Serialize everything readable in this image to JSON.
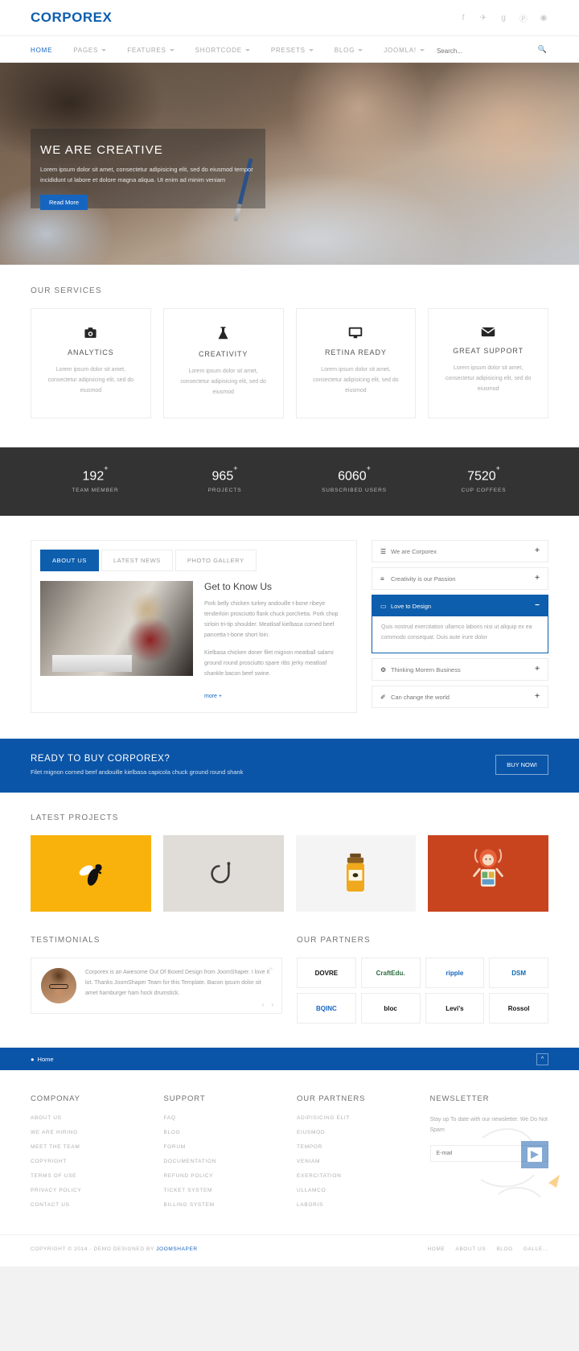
{
  "brand": {
    "logo": "CORPOREX",
    "accent": "#0d5ead",
    "dark": "#333333"
  },
  "topbar": {
    "social": [
      {
        "name": "facebook-icon",
        "glyph": "f"
      },
      {
        "name": "twitter-icon",
        "glyph": "✈"
      },
      {
        "name": "google-plus-icon",
        "glyph": "g"
      },
      {
        "name": "pinterest-icon",
        "glyph": "Ⓟ"
      },
      {
        "name": "dribbble-icon",
        "glyph": "◉"
      }
    ]
  },
  "nav": {
    "items": [
      {
        "label": "HOME",
        "caret": false,
        "active": true
      },
      {
        "label": "PAGES",
        "caret": true,
        "active": false
      },
      {
        "label": "FEATURES",
        "caret": true,
        "active": false
      },
      {
        "label": "SHORTCODE",
        "caret": true,
        "active": false
      },
      {
        "label": "PRESETS",
        "caret": true,
        "active": false
      },
      {
        "label": "BLOG",
        "caret": true,
        "active": false
      },
      {
        "label": "JOOMLA!",
        "caret": true,
        "active": false
      }
    ],
    "search": {
      "placeholder": "Search...",
      "value": ""
    }
  },
  "hero": {
    "title": "WE ARE CREATIVE",
    "subtitle": "Lorem ipsum dolor sit amet, consectetur adipisicing elit, sed do eiusmod tempor incididunt ut labore et dolore magna aliqua. Ut enim ad minim veniam",
    "button": "Read More"
  },
  "services": {
    "title": "OUR SERVICES",
    "items": [
      {
        "icon": "camera-icon",
        "name": "ANALYTICS",
        "desc": "Lorem ipsum dolor sit amet, consectetur adipisicing elit, sed do eiusmod"
      },
      {
        "icon": "flask-icon",
        "name": "CREATIVITY",
        "desc": "Lorem ipsum dolor sit amet, consectetur adipisicing elit, sed do eiusmod"
      },
      {
        "icon": "monitor-icon",
        "name": "RETINA READY",
        "desc": "Lorem ipsum dolor sit amet, consectetur adipisicing elit, sed do eiusmod"
      },
      {
        "icon": "envelope-icon",
        "name": "GREAT SUPPORT",
        "desc": "Lorem ipsum dolor sit amet, consectetur adipisicing elit, sed do eiusmod"
      }
    ]
  },
  "counters": [
    {
      "value": "192",
      "suffix": "+",
      "label": "TEAM MEMBER"
    },
    {
      "value": "965",
      "suffix": "+",
      "label": "PROJECTS"
    },
    {
      "value": "6060",
      "suffix": "+",
      "label": "SUBSCRIBED USERS"
    },
    {
      "value": "7520",
      "suffix": "+",
      "label": "CUP COFFEES"
    }
  ],
  "about": {
    "tabs": [
      {
        "label": "ABOUT US",
        "active": true
      },
      {
        "label": "LATEST NEWS",
        "active": false
      },
      {
        "label": "PHOTO GALLERY",
        "active": false
      }
    ],
    "heading": "Get to Know Us",
    "p1": "Pork belly chicken turkey andouille t-bone ribeye tenderloin prosciutto flank chuck porchetta. Pork chop sirloin tri-tip shoulder. Meatloaf kielbasa corned beef pancetta t-bone short loin.",
    "p2": "Kielbasa chicken doner filet mignon meatball salami ground round prosciutto spare ribs jerky meatloaf shankle bacon beef swine.",
    "more": "more +"
  },
  "accordion": [
    {
      "icon": "file-icon",
      "glyph": "☰",
      "title": "We are Corporex",
      "sign": "+",
      "open": false,
      "body": ""
    },
    {
      "icon": "layers-icon",
      "glyph": "≡",
      "title": "Creativity is our Passion",
      "sign": "+",
      "open": false,
      "body": ""
    },
    {
      "icon": "laptop-icon",
      "glyph": "▭",
      "title": "Love to Design",
      "sign": "−",
      "open": true,
      "body": "Quis nostrud exercitation ullamco laboris nisi ut aliquip ex ea commodo consequat. Duis aute irure dolor"
    },
    {
      "icon": "gear-icon",
      "glyph": "⚙",
      "title": "Thinking Morern Business",
      "sign": "+",
      "open": false,
      "body": ""
    },
    {
      "icon": "wrench-icon",
      "glyph": "✐",
      "title": "Can change the world",
      "sign": "+",
      "open": false,
      "body": ""
    }
  ],
  "cta": {
    "heading": "READY TO BUY CORPOREX?",
    "sub": "Filet mignon corned beef andouille kielbasa capicola chuck ground round shank",
    "button": "BUY NOW!"
  },
  "projects": {
    "title": "LATEST PROJECTS",
    "items": [
      {
        "name": "bee-logo-project",
        "bg": "#f9b20b"
      },
      {
        "name": "hook-logo-project",
        "bg": "#e0dcd7"
      },
      {
        "name": "honey-jar-project",
        "bg": "#f4f4f4"
      },
      {
        "name": "illustration-project",
        "bg": "#c8441e"
      }
    ]
  },
  "testimonials": {
    "title": "TESTIMONIALS",
    "quote": "Corporex is an Awesome Out Of Boxed Design from JoomShaper. I love it lot. Thanks JoomShaper Team for this Template. Bacon ipsum dolor sit amet hamburger ham hock drumstick.",
    "prev": "‹",
    "next": "›"
  },
  "partners": {
    "title": "OUR PARTNERS",
    "items": [
      {
        "label": "DOVRE",
        "cls": "c1"
      },
      {
        "label": "CraftEdu.",
        "cls": "c2"
      },
      {
        "label": "ripple",
        "cls": "c3"
      },
      {
        "label": "DSM",
        "cls": "c4"
      },
      {
        "label": "BQINC",
        "cls": "c5"
      },
      {
        "label": "bloc",
        "cls": "c6"
      },
      {
        "label": "Levi's",
        "cls": "c7"
      },
      {
        "label": "Rossol",
        "cls": "c8"
      }
    ]
  },
  "breadcrumb": {
    "home": "Home",
    "to_top": "^"
  },
  "footer": {
    "columns": [
      {
        "title": "COMPONAY",
        "links": [
          "ABOUT US",
          "WE ARE HIRING",
          "MEET THE TEAM",
          "COPYRIGHT",
          "TERMS OF USE",
          "PRIVACY POLICY",
          "CONTACT US"
        ]
      },
      {
        "title": "SUPPORT",
        "links": [
          "FAQ",
          "BLOG",
          "FORUM",
          "DOCUMENTATION",
          "REFUND POLICY",
          "TICKET SYSTEM",
          "BILLING SYSTEM"
        ]
      },
      {
        "title": "OUR PARTNERS",
        "links": [
          "ADIPISICING ELIT",
          "EIUSMOD",
          "TEMPOR",
          "VENIAM",
          "EXERCITATION",
          "ULLAMCO",
          "LABORIS"
        ]
      }
    ],
    "newsletter": {
      "title": "NEWSLETTER",
      "text": "Stay up To date with our newsletter. We Do Not Spam",
      "placeholder": "E-mail",
      "value": ""
    }
  },
  "copyright": {
    "left": "COPYRIGHT © 2014 - DEMO   DESIGNED BY ",
    "brand": "JOOMSHAPER",
    "links": [
      "HOME",
      "ABOUT US",
      "BLOG",
      "GALLE..."
    ]
  }
}
